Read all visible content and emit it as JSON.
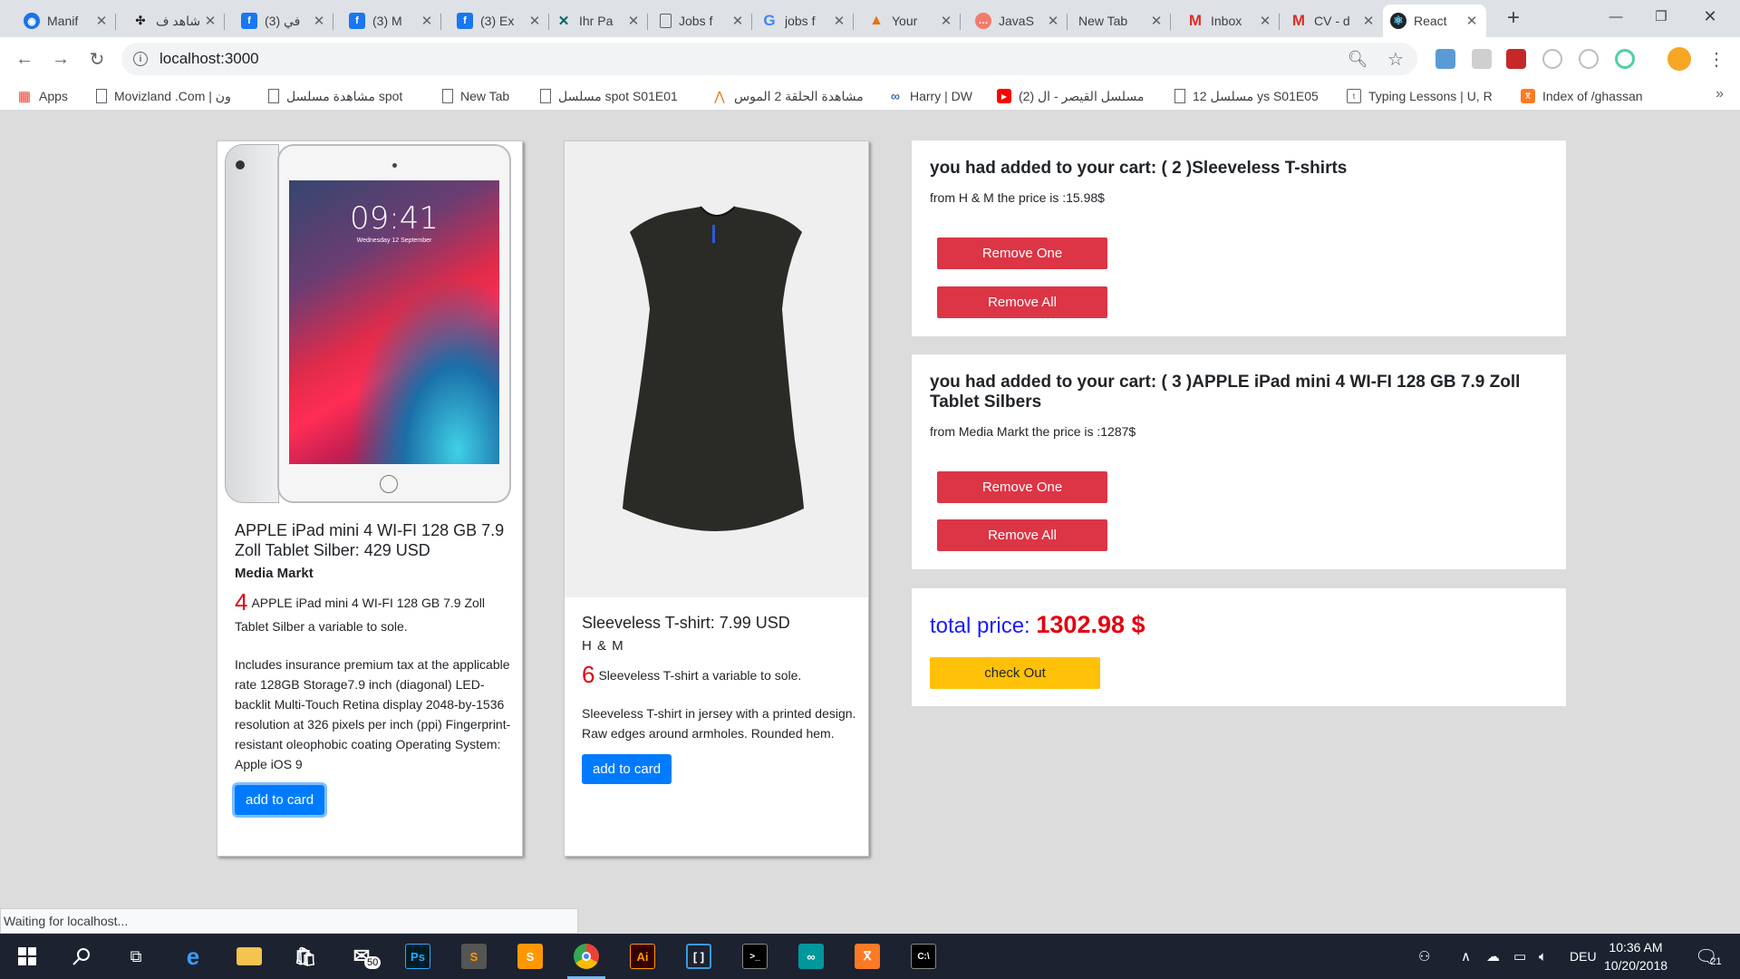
{
  "browser": {
    "tabs": [
      {
        "title": "Manif",
        "icon": "chrome-icon",
        "color": "#1a73e8"
      },
      {
        "title": "شاهد ف",
        "icon": "plug-icon",
        "color": "#202124"
      },
      {
        "title": "(3) في",
        "icon": "facebook-icon",
        "color": "#1877f2"
      },
      {
        "title": "(3) M",
        "icon": "facebook-icon",
        "color": "#1877f2"
      },
      {
        "title": "(3) Ex",
        "icon": "facebook-icon",
        "color": "#1877f2"
      },
      {
        "title": "Ihr Pa",
        "icon": "xing-icon",
        "color": "#026466"
      },
      {
        "title": "Jobs f",
        "icon": "document-icon",
        "color": "#5f6368"
      },
      {
        "title": "jobs f",
        "icon": "google-icon",
        "color": "#4285f4"
      },
      {
        "title": "Your",
        "icon": "alert-icon",
        "color": "#e8710a"
      },
      {
        "title": "JavaS",
        "icon": "javascript-icon",
        "color": "#f37b6b"
      },
      {
        "title": "New Tab",
        "icon": "",
        "color": ""
      },
      {
        "title": "Inbox",
        "icon": "gmail-icon",
        "color": "#d93025"
      },
      {
        "title": "CV - d",
        "icon": "gmail-icon",
        "color": "#d93025"
      },
      {
        "title": "React",
        "icon": "react-icon",
        "color": "#20232a"
      }
    ],
    "url": "localhost:3000",
    "bookmarks": [
      {
        "label": "Apps",
        "icon": "apps-grid-icon"
      },
      {
        "label": "Movizland .Com | ون",
        "icon": "document-icon"
      },
      {
        "label": "مشاهدة مسلسل spot",
        "icon": "document-icon"
      },
      {
        "label": "New Tab",
        "icon": "document-icon"
      },
      {
        "label": "مسلسل spot S01E01",
        "icon": "document-icon"
      },
      {
        "label": "مشاهدة الحلقة 2 الموس",
        "icon": "arrow-icon"
      },
      {
        "label": "Harry | DW",
        "icon": "infinity-icon"
      },
      {
        "label": "(2) مسلسل القيصر - ال",
        "icon": "youtube-icon"
      },
      {
        "label": "مسلسل 12 ys S01E05",
        "icon": "document-icon"
      },
      {
        "label": "Typing Lessons | U, R",
        "icon": "typing-icon"
      },
      {
        "label": "Index of /ghassan",
        "icon": "xampp-icon"
      }
    ],
    "status_text": "Waiting for localhost..."
  },
  "products": [
    {
      "title": "APPLE iPad mini 4 WI-FI 128 GB 7.9 Zoll Tablet Silber: 429 USD",
      "store": "Media Markt",
      "qty": "4",
      "qty_text": "APPLE iPad mini 4 WI-FI 128 GB 7.9 Zoll Tablet Silber a variable to sole.",
      "description": "Includes insurance premium tax at the applicable rate 128GB Storage7.9 inch (diagonal) LED-backlit Multi-Touch Retina display 2048-by-1536 resolution at 326 pixels per inch (ppi) Fingerprint-resistant oleophobic coating Operating System: Apple iOS 9",
      "button": "add to card",
      "screen_time": "09:41",
      "screen_date": "Wednesday 12 September"
    },
    {
      "title": "Sleeveless T-shirt: 7.99 USD",
      "store": "H & M",
      "qty": "6",
      "qty_text": "Sleeveless T-shirt a variable to sole.",
      "description": "Sleeveless T-shirt in jersey with a printed design. Raw edges around armholes. Rounded hem.",
      "button": "add to card"
    }
  ],
  "cart": [
    {
      "heading": "you had added to your cart: ( 2 )Sleeveless T-shirts",
      "sub": "from H & M the price is :15.98$",
      "remove_one": "Remove One",
      "remove_all": "Remove All"
    },
    {
      "heading": "you had added to your cart: ( 3 )APPLE iPad mini 4 WI-FI 128 GB 7.9 Zoll Tablet Silbers",
      "sub": "from Media Markt the price is :1287$",
      "remove_one": "Remove One",
      "remove_all": "Remove All"
    }
  ],
  "total": {
    "label": "total price:",
    "value": "1302.98 $",
    "checkout": "check Out"
  },
  "taskbar": {
    "mail_badge": "50",
    "language": "DEU",
    "time": "10:36 AM",
    "date": "10/20/2018",
    "notifications": "21"
  },
  "colors": {
    "accent_blue": "#007bff",
    "danger_red": "#dc3545",
    "warning_yellow": "#ffc107",
    "qty_red": "#e3000f"
  }
}
